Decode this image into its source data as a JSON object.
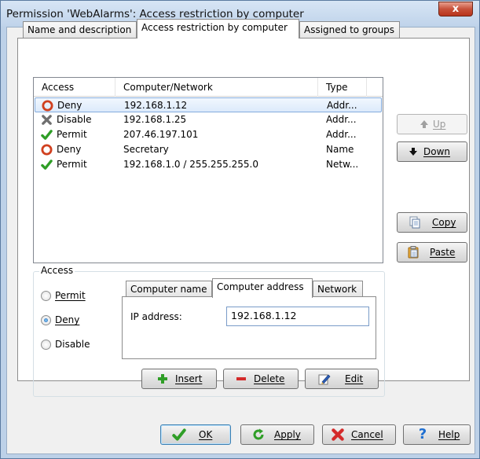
{
  "window": {
    "title": "Permission 'WebAlarms': Access restriction by computer",
    "close_glyph": "x"
  },
  "tabs": [
    {
      "label": "Name and description",
      "active": false
    },
    {
      "label": "Access restriction by computer",
      "active": true
    },
    {
      "label": "Assigned to groups",
      "active": false
    }
  ],
  "list": {
    "columns": [
      "Access",
      "Computer/Network",
      "Type"
    ],
    "rows": [
      {
        "icon": "deny-icon",
        "access": "Deny",
        "computer": "192.168.1.12",
        "type": "Addr...",
        "selected": true
      },
      {
        "icon": "disable-icon",
        "access": "Disable",
        "computer": "192.168.1.25",
        "type": "Addr...",
        "selected": false
      },
      {
        "icon": "permit-icon",
        "access": "Permit",
        "computer": "207.46.197.101",
        "type": "Addr...",
        "selected": false
      },
      {
        "icon": "deny-icon",
        "access": "Deny",
        "computer": "Secretary",
        "type": "Name",
        "selected": false
      },
      {
        "icon": "permit-icon",
        "access": "Permit",
        "computer": "192.168.1.0 / 255.255.255.0",
        "type": "Netw...",
        "selected": false
      }
    ]
  },
  "side_buttons": {
    "up": "Up",
    "down": "Down",
    "copy": "Copy",
    "paste": "Paste"
  },
  "access_group": {
    "label": "Access",
    "options": [
      {
        "label": "Permit",
        "checked": false
      },
      {
        "label": "Deny",
        "checked": true
      },
      {
        "label": "Disable",
        "checked": false
      }
    ]
  },
  "sub_tabs": [
    {
      "label": "Computer name",
      "active": false
    },
    {
      "label": "Computer address",
      "active": true
    },
    {
      "label": "Network",
      "active": false
    }
  ],
  "ip": {
    "label": "IP address:",
    "value": "192.168.1.12"
  },
  "action_buttons": {
    "insert": "Insert",
    "delete": "Delete",
    "edit": "Edit"
  },
  "footer": {
    "ok": "OK",
    "apply": "Apply",
    "cancel": "Cancel",
    "help": "Help"
  },
  "colors": {
    "deny": "#d0401f",
    "permit": "#2f9e27",
    "disable": "#6f6f6f",
    "selection": "#dceafb"
  }
}
